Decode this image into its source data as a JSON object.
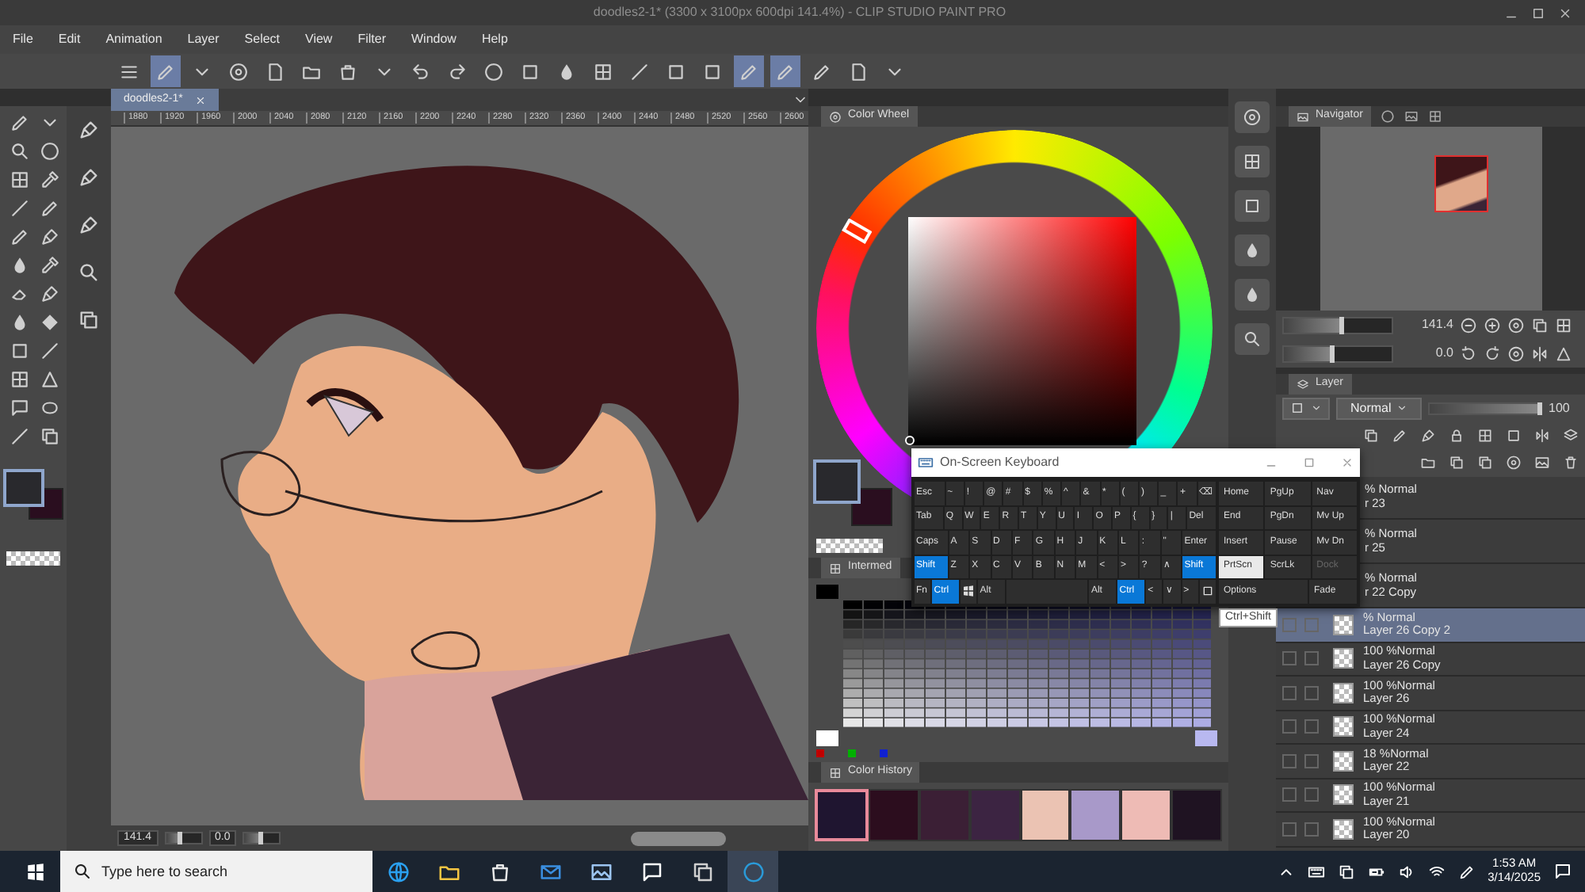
{
  "window": {
    "title": "doodles2-1* (3300 x 3100px 600dpi 141.4%) - CLIP STUDIO PAINT PRO"
  },
  "menu": [
    "File",
    "Edit",
    "Animation",
    "Layer",
    "Select",
    "View",
    "Filter",
    "Window",
    "Help"
  ],
  "toolbar": [
    {
      "selected": false
    },
    {
      "selected": true
    },
    {
      "selected": false
    },
    {
      "selected": false
    },
    {
      "selected": false
    },
    {
      "selected": false
    },
    {
      "selected": false
    },
    {
      "selected": false
    },
    {
      "selected": false
    },
    {
      "selected": false
    },
    {
      "selected": false
    },
    {
      "selected": false
    },
    {
      "selected": false
    },
    {
      "selected": false
    },
    {
      "selected": false
    },
    {
      "selected": false
    },
    {
      "selected": false
    },
    {
      "selected": true
    },
    {
      "selected": true
    },
    {
      "selected": false
    },
    {
      "selected": false
    },
    {
      "selected": false
    }
  ],
  "tool_colors": [
    {
      "color": "#29292d",
      "selected": true
    },
    {
      "color": "#2a0e1f",
      "selected": false
    }
  ],
  "canvas": {
    "tab": "doodles2-1*",
    "ruler": [
      "1880",
      "1920",
      "1960",
      "2000",
      "2040",
      "2080",
      "2120",
      "2160",
      "2200",
      "2240",
      "2280",
      "2320",
      "2360",
      "2400",
      "2440",
      "2480",
      "2520",
      "2560",
      "2600"
    ],
    "zoom": "141.4",
    "zoom_slider": {
      "level": 0.45
    },
    "angle": "0.0",
    "angle_slider": {
      "level": 0.5
    }
  },
  "color_wheel": {
    "title": "Color Wheel",
    "colors": [
      {
        "color": "#29292d",
        "selected": true
      },
      {
        "color": "#2a0e1f",
        "selected": false
      }
    ]
  },
  "intermediate": {
    "title": "Intermed"
  },
  "color_history": {
    "title": "Color History",
    "swatches": [
      {
        "color": "#1f1530",
        "selected": true
      },
      {
        "color": "#2c0d1e",
        "selected": false
      },
      {
        "color": "#3b1f35",
        "selected": false
      },
      {
        "color": "#3c2442",
        "selected": false
      },
      {
        "color": "#ebc3b3",
        "selected": false
      },
      {
        "color": "#a899c9",
        "selected": false
      },
      {
        "color": "#eebbb5",
        "selected": false
      },
      {
        "color": "#1f1322",
        "selected": false
      }
    ]
  },
  "navigator": {
    "title": "Navigator",
    "zoom": "141.4",
    "zoom_slider": {
      "level": 0.55
    },
    "angle": "0.0",
    "angle_slider": {
      "level": 0.45
    }
  },
  "layer_panel": {
    "title": "Layer",
    "blend_mode": "Normal",
    "opacity": "100",
    "opacity_slider": {
      "level": 1
    },
    "layers": [
      {
        "kind": "cut",
        "mode": "% Normal",
        "name": "r 23",
        "selected": false
      },
      {
        "kind": "cut",
        "mode": "% Normal",
        "name": "r 25",
        "selected": false
      },
      {
        "kind": "cut",
        "mode": "% Normal",
        "name": "r 22 Copy",
        "selected": false
      },
      {
        "kind": "full",
        "mode": "% Normal",
        "name": "Layer 26 Copy 2",
        "selected": true
      },
      {
        "kind": "full",
        "mode": "100 %Normal",
        "name": "Layer 26 Copy",
        "selected": false
      },
      {
        "kind": "full",
        "mode": "100 %Normal",
        "name": "Layer 26",
        "selected": false
      },
      {
        "kind": "full",
        "mode": "100 %Normal",
        "name": "Layer 24",
        "selected": false
      },
      {
        "kind": "full",
        "mode": "18 %Normal",
        "name": "Layer 22",
        "selected": false
      },
      {
        "kind": "full",
        "mode": "100 %Normal",
        "name": "Layer 21",
        "selected": false
      },
      {
        "kind": "full",
        "mode": "100 %Normal",
        "name": "Layer 20",
        "selected": false
      }
    ]
  },
  "keyboard": {
    "title": "On-Screen Keyboard",
    "rows": [
      {
        "keys": [
          {
            "kind": "key",
            "label": "Esc",
            "on": false
          },
          {
            "kind": "key",
            "label": "~",
            "on": false
          },
          {
            "kind": "key",
            "label": "!",
            "on": false
          },
          {
            "kind": "key",
            "label": "@",
            "on": false
          },
          {
            "kind": "key",
            "label": "#",
            "on": false
          },
          {
            "kind": "key",
            "label": "$",
            "on": false
          },
          {
            "kind": "key",
            "label": "%",
            "on": false
          },
          {
            "kind": "key",
            "label": "^",
            "on": false
          },
          {
            "kind": "key",
            "label": "&",
            "on": false
          },
          {
            "kind": "key",
            "label": "*",
            "on": false
          },
          {
            "kind": "key",
            "label": "(",
            "on": false
          },
          {
            "kind": "key",
            "label": ")",
            "on": false
          },
          {
            "kind": "key",
            "label": "_",
            "on": false
          },
          {
            "kind": "key",
            "label": "+",
            "on": false
          },
          {
            "kind": "key",
            "label": "⌫",
            "on": false
          }
        ]
      },
      {
        "keys": [
          {
            "kind": "key",
            "label": "Tab",
            "on": false
          },
          {
            "kind": "key",
            "label": "Q",
            "on": false
          },
          {
            "kind": "key",
            "label": "W",
            "on": false
          },
          {
            "kind": "key",
            "label": "E",
            "on": false
          },
          {
            "kind": "key",
            "label": "R",
            "on": false
          },
          {
            "kind": "key",
            "label": "T",
            "on": false
          },
          {
            "kind": "key",
            "label": "Y",
            "on": false
          },
          {
            "kind": "key",
            "label": "U",
            "on": false
          },
          {
            "kind": "key",
            "label": "I",
            "on": false
          },
          {
            "kind": "key",
            "label": "O",
            "on": false
          },
          {
            "kind": "key",
            "label": "P",
            "on": false
          },
          {
            "kind": "key",
            "label": "{",
            "on": false
          },
          {
            "kind": "key",
            "label": "}",
            "on": false
          },
          {
            "kind": "key",
            "label": "|",
            "on": false
          },
          {
            "kind": "key",
            "label": "Del",
            "on": false
          }
        ]
      },
      {
        "keys": [
          {
            "kind": "key",
            "label": "Caps",
            "on": false
          },
          {
            "kind": "key",
            "label": "A",
            "on": false
          },
          {
            "kind": "key",
            "label": "S",
            "on": false
          },
          {
            "kind": "key",
            "label": "D",
            "on": false
          },
          {
            "kind": "key",
            "label": "F",
            "on": false
          },
          {
            "kind": "key",
            "label": "G",
            "on": false
          },
          {
            "kind": "key",
            "label": "H",
            "on": false
          },
          {
            "kind": "key",
            "label": "J",
            "on": false
          },
          {
            "kind": "key",
            "label": "K",
            "on": false
          },
          {
            "kind": "key",
            "label": "L",
            "on": false
          },
          {
            "kind": "key",
            "label": ":",
            "on": false
          },
          {
            "kind": "key",
            "label": "\"",
            "on": false
          },
          {
            "kind": "key",
            "label": "Enter",
            "on": false
          }
        ]
      },
      {
        "keys": [
          {
            "kind": "key",
            "label": "Shift",
            "on": true
          },
          {
            "kind": "key",
            "label": "Z",
            "on": false
          },
          {
            "kind": "key",
            "label": "X",
            "on": false
          },
          {
            "kind": "key",
            "label": "C",
            "on": false
          },
          {
            "kind": "key",
            "label": "V",
            "on": false
          },
          {
            "kind": "key",
            "label": "B",
            "on": false
          },
          {
            "kind": "key",
            "label": "N",
            "on": false
          },
          {
            "kind": "key",
            "label": "M",
            "on": false
          },
          {
            "kind": "key",
            "label": "<",
            "on": false
          },
          {
            "kind": "key",
            "label": ">",
            "on": false
          },
          {
            "kind": "key",
            "label": "?",
            "on": false
          },
          {
            "kind": "key",
            "label": "∧",
            "on": false
          },
          {
            "kind": "key",
            "label": "Shift",
            "on": true
          }
        ]
      },
      {
        "keys": [
          {
            "kind": "key",
            "label": "Fn",
            "on": false
          },
          {
            "kind": "key",
            "label": "Ctrl",
            "on": true
          },
          {
            "kind": "win",
            "on": false
          },
          {
            "kind": "key",
            "label": "Alt",
            "on": false
          },
          {
            "kind": "space",
            "on": false
          },
          {
            "kind": "key",
            "label": "Alt",
            "on": false
          },
          {
            "kind": "key",
            "label": "Ctrl",
            "on": true
          },
          {
            "kind": "key",
            "label": "<",
            "on": false
          },
          {
            "kind": "key",
            "label": "∨",
            "on": false
          },
          {
            "kind": "key",
            "label": ">",
            "on": false
          },
          {
            "kind": "menu",
            "on": false
          }
        ]
      }
    ],
    "side_rows": [
      [
        {
          "kind": "key",
          "label": "Home",
          "hovered": false,
          "disabled": false
        },
        {
          "kind": "key",
          "label": "PgUp",
          "hovered": false,
          "disabled": false
        },
        {
          "kind": "key",
          "label": "Nav",
          "hovered": false,
          "disabled": false
        }
      ],
      [
        {
          "kind": "key",
          "label": "End",
          "hovered": false,
          "disabled": false
        },
        {
          "kind": "key",
          "label": "PgDn",
          "hovered": false,
          "disabled": false
        },
        {
          "kind": "key",
          "label": "Mv Up",
          "hovered": false,
          "disabled": false
        }
      ],
      [
        {
          "kind": "key",
          "label": "Insert",
          "hovered": false,
          "disabled": false
        },
        {
          "kind": "key",
          "label": "Pause",
          "hovered": false,
          "disabled": false
        },
        {
          "kind": "key",
          "label": "Mv Dn",
          "hovered": false,
          "disabled": false
        }
      ],
      [
        {
          "kind": "key",
          "label": "PrtScn",
          "hovered": true,
          "disabled": false
        },
        {
          "kind": "key",
          "label": "ScrLk",
          "hovered": false,
          "disabled": false
        },
        {
          "kind": "key",
          "label": "Dock",
          "hovered": false,
          "disabled": true
        }
      ],
      [
        {
          "kind": "wide",
          "label": "Options",
          "hovered": false,
          "disabled": false
        },
        {
          "kind": "key",
          "label": "Fade",
          "hovered": false,
          "disabled": false
        }
      ]
    ],
    "tooltip": "Ctrl+Shift"
  },
  "taskbar": {
    "search_placeholder": "Type here to search",
    "apps": [
      {
        "selected": false
      },
      {
        "selected": false
      },
      {
        "selected": false
      },
      {
        "selected": false
      },
      {
        "selected": false
      },
      {
        "selected": false
      },
      {
        "selected": false
      },
      {
        "selected": true
      }
    ],
    "time": "1:53 AM",
    "date": "3/14/2025"
  }
}
